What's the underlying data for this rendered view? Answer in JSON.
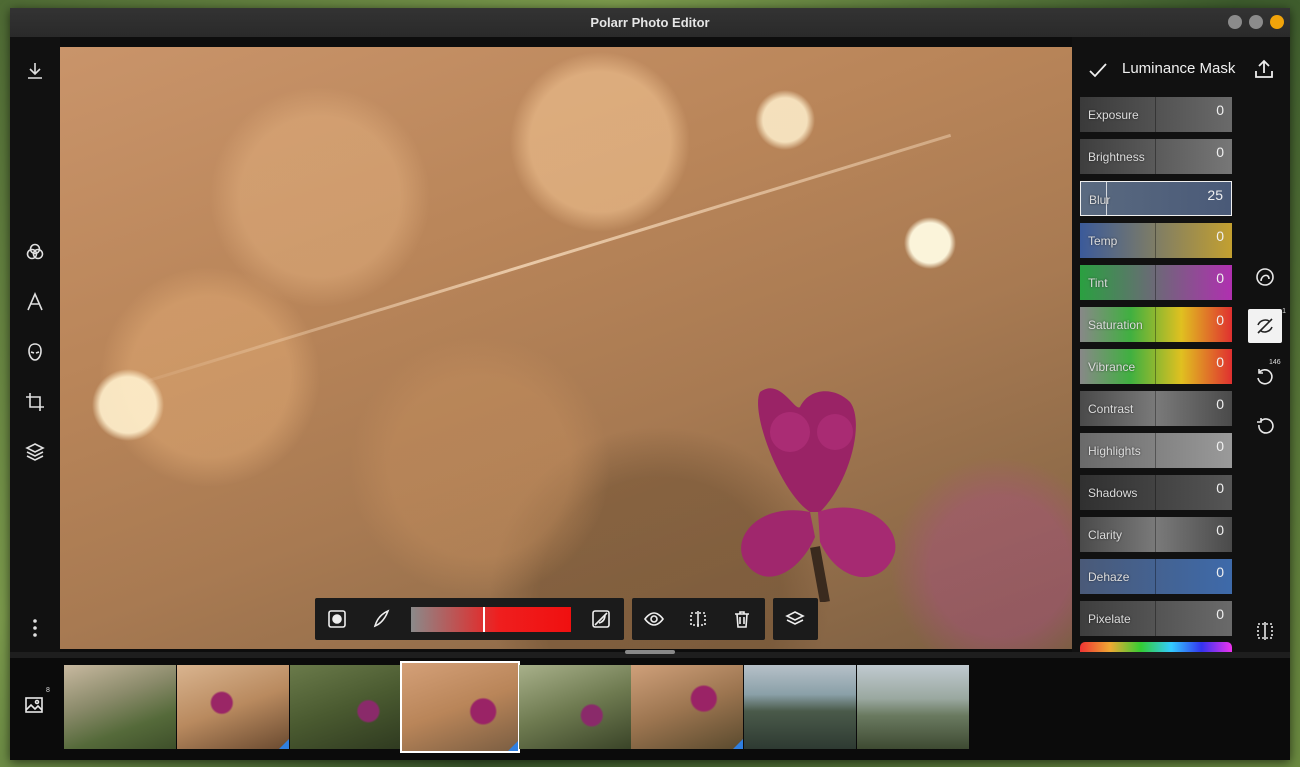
{
  "window": {
    "title": "Polarr Photo Editor"
  },
  "left_toolbar": {
    "items": [
      "download-icon",
      "filters-icon",
      "text-icon",
      "face-icon",
      "crop-icon",
      "layers-icon",
      "more-icon"
    ]
  },
  "right_panel": {
    "title": "Luminance Mask",
    "sliders": [
      {
        "label": "Exposure",
        "value": "0"
      },
      {
        "label": "Brightness",
        "value": "0"
      },
      {
        "label": "Blur",
        "value": "25"
      },
      {
        "label": "Temp",
        "value": "0"
      },
      {
        "label": "Tint",
        "value": "0"
      },
      {
        "label": "Saturation",
        "value": "0"
      },
      {
        "label": "Vibrance",
        "value": "0"
      },
      {
        "label": "Contrast",
        "value": "0"
      },
      {
        "label": "Highlights",
        "value": "0"
      },
      {
        "label": "Shadows",
        "value": "0"
      },
      {
        "label": "Clarity",
        "value": "0"
      },
      {
        "label": "Dehaze",
        "value": "0"
      },
      {
        "label": "Pixelate",
        "value": "0"
      }
    ],
    "active_slider": "Blur"
  },
  "side_icons": {
    "history_count": "146",
    "mask_badge": "1"
  },
  "mask_toolbar": {
    "luminance_range": {
      "handle_fraction": 0.45
    }
  },
  "filmstrip": {
    "count_badge": "8",
    "selected_index": 3
  },
  "colors": {
    "accent": "#f0a30a",
    "mask_red": "#f01010",
    "edited_corner": "#2f7fe0"
  }
}
